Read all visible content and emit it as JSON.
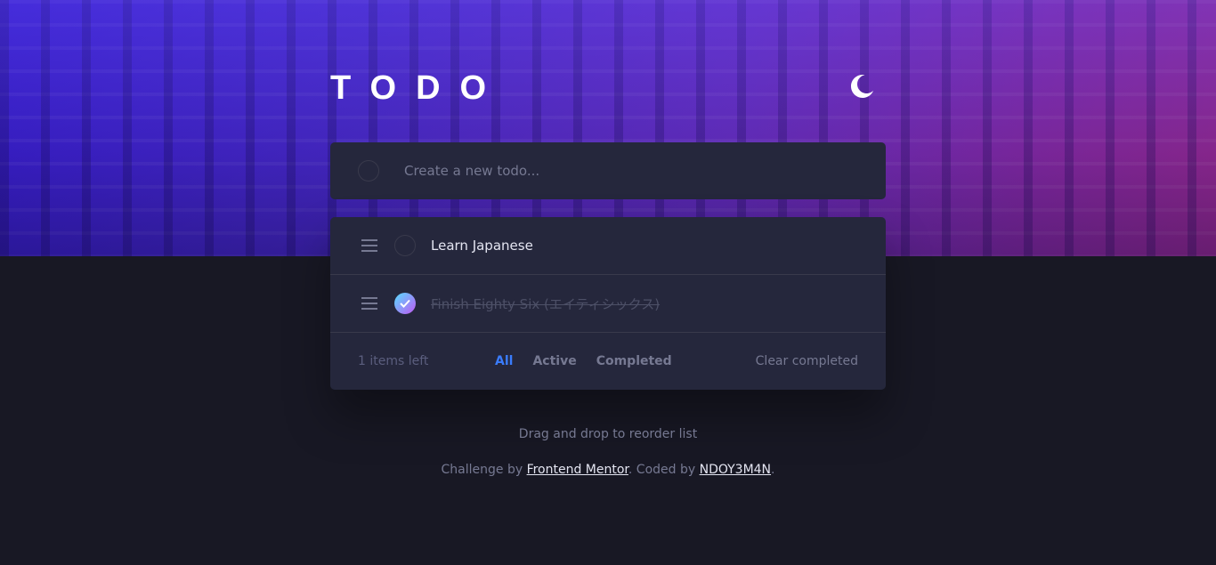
{
  "app": {
    "title": "TODO",
    "theme_toggle_icon": "moon-icon"
  },
  "new_todo": {
    "placeholder": "Create a new todo...",
    "value": ""
  },
  "todos": [
    {
      "text": "Learn Japanese",
      "completed": false
    },
    {
      "text": "Finish Eighty Six (エイティシックス)",
      "completed": true
    }
  ],
  "footer": {
    "items_left": "1 items left",
    "filters": [
      {
        "label": "All",
        "active": true
      },
      {
        "label": "Active",
        "active": false
      },
      {
        "label": "Completed",
        "active": false
      }
    ],
    "clear_completed": "Clear completed"
  },
  "hint": "Drag and drop to reorder list",
  "attribution": {
    "prefix": "Challenge by ",
    "link1": "Frontend Mentor",
    "middle": ". Coded by ",
    "link2": "NDOY3M4N",
    "suffix": "."
  },
  "colors": {
    "page_bg": "#181824",
    "card_bg": "#25273c",
    "accent_active": "#3a7cfd",
    "check_gradient_start": "#57ddff",
    "check_gradient_end": "#c058f3"
  }
}
